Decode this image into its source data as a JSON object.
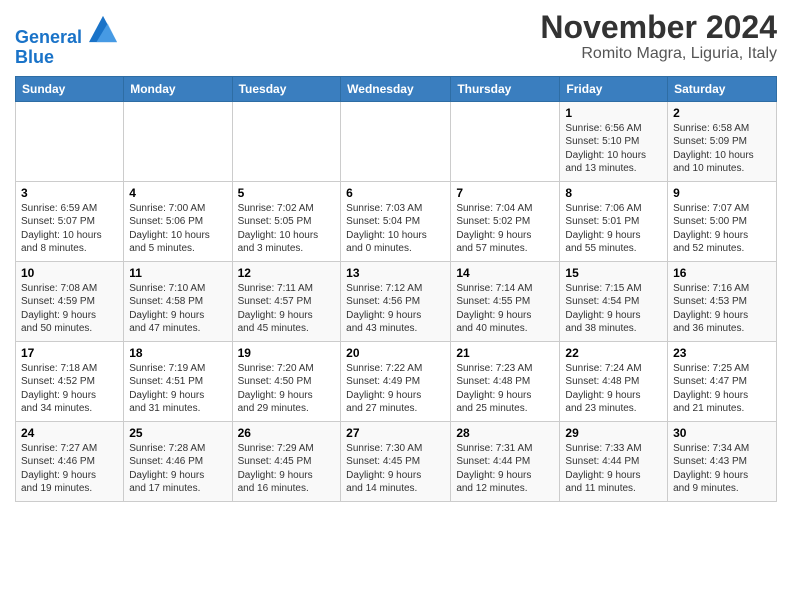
{
  "header": {
    "logo_line1": "General",
    "logo_line2": "Blue",
    "title": "November 2024",
    "subtitle": "Romito Magra, Liguria, Italy"
  },
  "weekdays": [
    "Sunday",
    "Monday",
    "Tuesday",
    "Wednesday",
    "Thursday",
    "Friday",
    "Saturday"
  ],
  "weeks": [
    [
      {
        "day": "",
        "info": ""
      },
      {
        "day": "",
        "info": ""
      },
      {
        "day": "",
        "info": ""
      },
      {
        "day": "",
        "info": ""
      },
      {
        "day": "",
        "info": ""
      },
      {
        "day": "1",
        "info": "Sunrise: 6:56 AM\nSunset: 5:10 PM\nDaylight: 10 hours\nand 13 minutes."
      },
      {
        "day": "2",
        "info": "Sunrise: 6:58 AM\nSunset: 5:09 PM\nDaylight: 10 hours\nand 10 minutes."
      }
    ],
    [
      {
        "day": "3",
        "info": "Sunrise: 6:59 AM\nSunset: 5:07 PM\nDaylight: 10 hours\nand 8 minutes."
      },
      {
        "day": "4",
        "info": "Sunrise: 7:00 AM\nSunset: 5:06 PM\nDaylight: 10 hours\nand 5 minutes."
      },
      {
        "day": "5",
        "info": "Sunrise: 7:02 AM\nSunset: 5:05 PM\nDaylight: 10 hours\nand 3 minutes."
      },
      {
        "day": "6",
        "info": "Sunrise: 7:03 AM\nSunset: 5:04 PM\nDaylight: 10 hours\nand 0 minutes."
      },
      {
        "day": "7",
        "info": "Sunrise: 7:04 AM\nSunset: 5:02 PM\nDaylight: 9 hours\nand 57 minutes."
      },
      {
        "day": "8",
        "info": "Sunrise: 7:06 AM\nSunset: 5:01 PM\nDaylight: 9 hours\nand 55 minutes."
      },
      {
        "day": "9",
        "info": "Sunrise: 7:07 AM\nSunset: 5:00 PM\nDaylight: 9 hours\nand 52 minutes."
      }
    ],
    [
      {
        "day": "10",
        "info": "Sunrise: 7:08 AM\nSunset: 4:59 PM\nDaylight: 9 hours\nand 50 minutes."
      },
      {
        "day": "11",
        "info": "Sunrise: 7:10 AM\nSunset: 4:58 PM\nDaylight: 9 hours\nand 47 minutes."
      },
      {
        "day": "12",
        "info": "Sunrise: 7:11 AM\nSunset: 4:57 PM\nDaylight: 9 hours\nand 45 minutes."
      },
      {
        "day": "13",
        "info": "Sunrise: 7:12 AM\nSunset: 4:56 PM\nDaylight: 9 hours\nand 43 minutes."
      },
      {
        "day": "14",
        "info": "Sunrise: 7:14 AM\nSunset: 4:55 PM\nDaylight: 9 hours\nand 40 minutes."
      },
      {
        "day": "15",
        "info": "Sunrise: 7:15 AM\nSunset: 4:54 PM\nDaylight: 9 hours\nand 38 minutes."
      },
      {
        "day": "16",
        "info": "Sunrise: 7:16 AM\nSunset: 4:53 PM\nDaylight: 9 hours\nand 36 minutes."
      }
    ],
    [
      {
        "day": "17",
        "info": "Sunrise: 7:18 AM\nSunset: 4:52 PM\nDaylight: 9 hours\nand 34 minutes."
      },
      {
        "day": "18",
        "info": "Sunrise: 7:19 AM\nSunset: 4:51 PM\nDaylight: 9 hours\nand 31 minutes."
      },
      {
        "day": "19",
        "info": "Sunrise: 7:20 AM\nSunset: 4:50 PM\nDaylight: 9 hours\nand 29 minutes."
      },
      {
        "day": "20",
        "info": "Sunrise: 7:22 AM\nSunset: 4:49 PM\nDaylight: 9 hours\nand 27 minutes."
      },
      {
        "day": "21",
        "info": "Sunrise: 7:23 AM\nSunset: 4:48 PM\nDaylight: 9 hours\nand 25 minutes."
      },
      {
        "day": "22",
        "info": "Sunrise: 7:24 AM\nSunset: 4:48 PM\nDaylight: 9 hours\nand 23 minutes."
      },
      {
        "day": "23",
        "info": "Sunrise: 7:25 AM\nSunset: 4:47 PM\nDaylight: 9 hours\nand 21 minutes."
      }
    ],
    [
      {
        "day": "24",
        "info": "Sunrise: 7:27 AM\nSunset: 4:46 PM\nDaylight: 9 hours\nand 19 minutes."
      },
      {
        "day": "25",
        "info": "Sunrise: 7:28 AM\nSunset: 4:46 PM\nDaylight: 9 hours\nand 17 minutes."
      },
      {
        "day": "26",
        "info": "Sunrise: 7:29 AM\nSunset: 4:45 PM\nDaylight: 9 hours\nand 16 minutes."
      },
      {
        "day": "27",
        "info": "Sunrise: 7:30 AM\nSunset: 4:45 PM\nDaylight: 9 hours\nand 14 minutes."
      },
      {
        "day": "28",
        "info": "Sunrise: 7:31 AM\nSunset: 4:44 PM\nDaylight: 9 hours\nand 12 minutes."
      },
      {
        "day": "29",
        "info": "Sunrise: 7:33 AM\nSunset: 4:44 PM\nDaylight: 9 hours\nand 11 minutes."
      },
      {
        "day": "30",
        "info": "Sunrise: 7:34 AM\nSunset: 4:43 PM\nDaylight: 9 hours\nand 9 minutes."
      }
    ]
  ]
}
